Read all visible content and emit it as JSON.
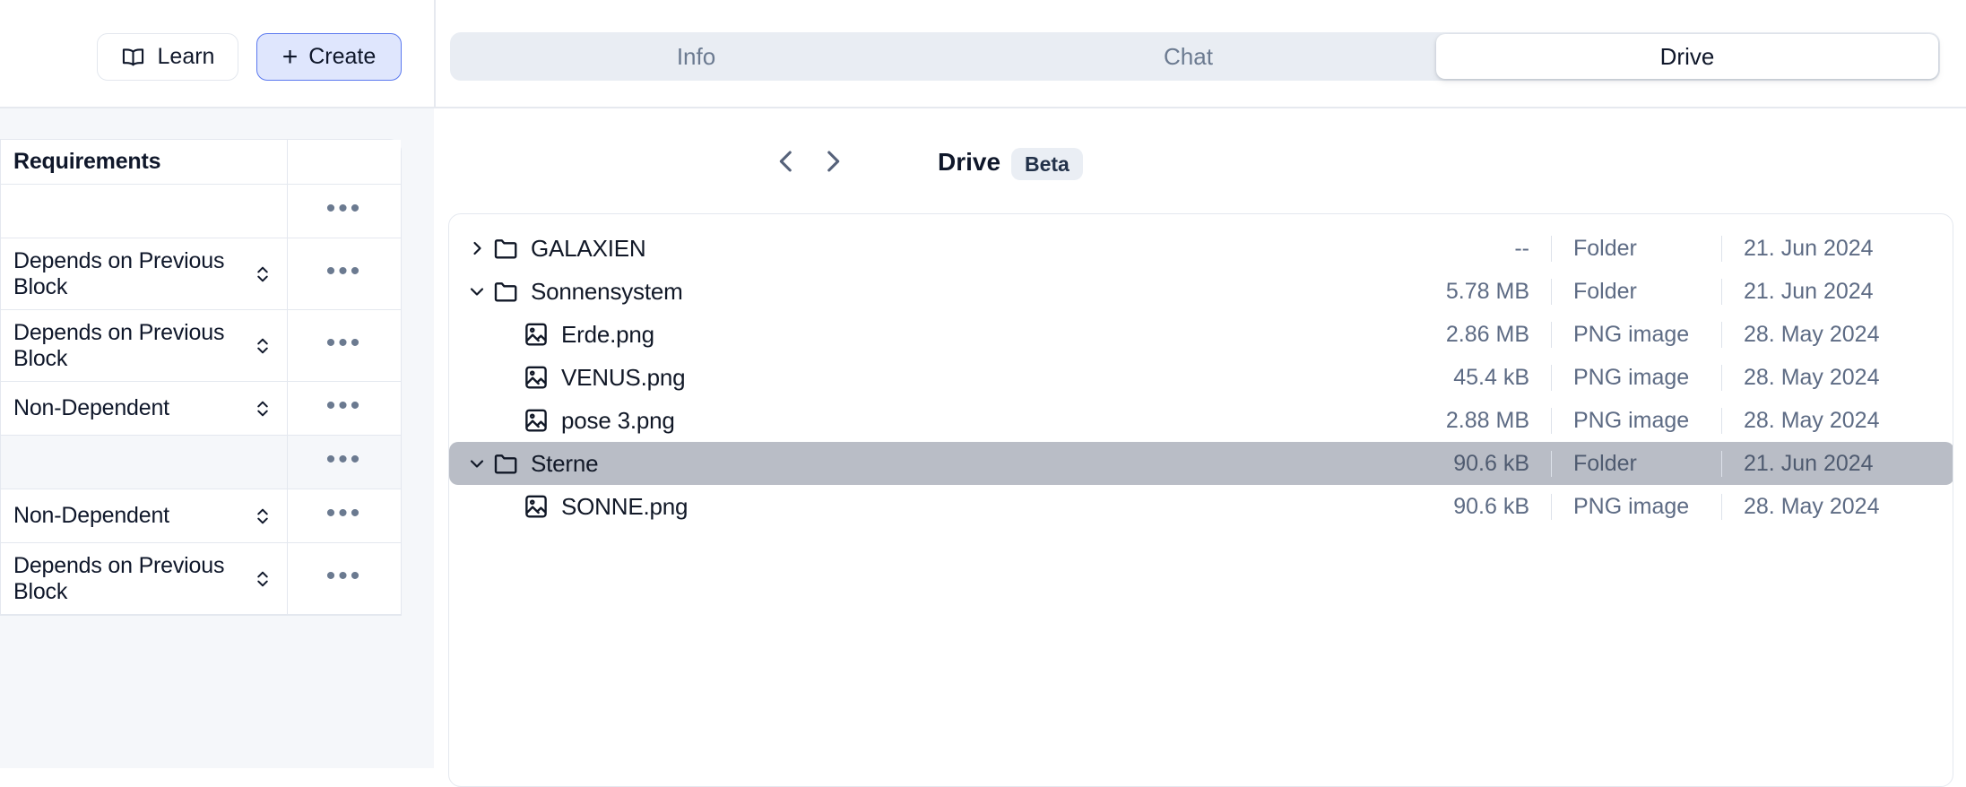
{
  "topbar": {
    "learn_button": "Learn",
    "learn_icon": "book-icon",
    "create_button": "Create",
    "create_icon": "plus-icon",
    "create_accent_border": "#5b79ef",
    "create_accent_bg": "#dfe6fd"
  },
  "tabs": {
    "items": [
      {
        "label": "Info",
        "active": false
      },
      {
        "label": "Chat",
        "active": false
      },
      {
        "label": "Drive",
        "active": true
      }
    ]
  },
  "sidebar": {
    "table": {
      "header": "Requirements",
      "rows": [
        {
          "label": "",
          "has_stepper": false,
          "shaded": false,
          "lines": 1
        },
        {
          "label": "Depends on Previous Block",
          "has_stepper": true,
          "shaded": false,
          "lines": 2
        },
        {
          "label": "Depends on Previous Block",
          "has_stepper": true,
          "shaded": false,
          "lines": 2
        },
        {
          "label": "Non-Dependent",
          "has_stepper": true,
          "shaded": false,
          "lines": 1
        },
        {
          "label": "",
          "has_stepper": false,
          "shaded": true,
          "lines": 1
        },
        {
          "label": "Non-Dependent",
          "has_stepper": true,
          "shaded": false,
          "lines": 1
        },
        {
          "label": "Depends on Previous Block",
          "has_stepper": true,
          "shaded": false,
          "lines": 2
        }
      ],
      "row_menu_label": "•••"
    }
  },
  "drive": {
    "title": "Drive",
    "badge": "Beta",
    "nav_back_icon": "chevron-left-icon",
    "nav_forward_icon": "chevron-right-icon",
    "actions": [
      {
        "name": "delete-button",
        "icon": "trash-icon"
      },
      {
        "name": "new-folder-button",
        "icon": "folder-plus-icon"
      },
      {
        "name": "upload-button",
        "icon": "upload-icon"
      }
    ],
    "files": [
      {
        "name": "GALAXIEN",
        "size": "--",
        "type": "Folder",
        "date": "21. Jun 2024",
        "kind": "folder",
        "expanded": false,
        "indent": 0,
        "selected": false
      },
      {
        "name": "Sonnensystem",
        "size": "5.78 MB",
        "type": "Folder",
        "date": "21. Jun 2024",
        "kind": "folder",
        "expanded": true,
        "indent": 0,
        "selected": false
      },
      {
        "name": "Erde.png",
        "size": "2.86 MB",
        "type": "PNG image",
        "date": "28. May 2024",
        "kind": "image",
        "expanded": null,
        "indent": 1,
        "selected": false
      },
      {
        "name": "VENUS.png",
        "size": "45.4 kB",
        "type": "PNG image",
        "date": "28. May 2024",
        "kind": "image",
        "expanded": null,
        "indent": 1,
        "selected": false
      },
      {
        "name": "pose 3.png",
        "size": "2.88 MB",
        "type": "PNG image",
        "date": "28. May 2024",
        "kind": "image",
        "expanded": null,
        "indent": 1,
        "selected": false
      },
      {
        "name": "Sterne",
        "size": "90.6 kB",
        "type": "Folder",
        "date": "21. Jun 2024",
        "kind": "folder",
        "expanded": true,
        "indent": 0,
        "selected": true
      },
      {
        "name": "SONNE.png",
        "size": "90.6 kB",
        "type": "PNG image",
        "date": "28. May 2024",
        "kind": "image",
        "expanded": null,
        "indent": 1,
        "selected": false
      }
    ],
    "selected_row_color": "#b9bdc6"
  }
}
